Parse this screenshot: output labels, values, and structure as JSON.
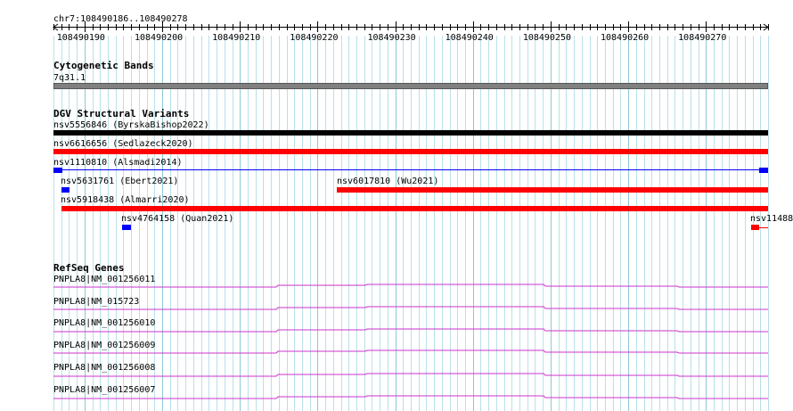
{
  "ruler": {
    "range_label": "chr7:108490186..108490278",
    "start": 108490186,
    "end": 108490278,
    "ticks": [
      "108490190",
      "108490200",
      "108490210",
      "108490220",
      "108490230",
      "108490240",
      "108490250",
      "108490260",
      "108490270"
    ]
  },
  "tracks": {
    "cytoband": {
      "title": "Cytogenetic Bands",
      "band_label": "7q31.1",
      "color": "#808080"
    },
    "dgv": {
      "title": "DGV Structural Variants",
      "features": [
        {
          "label": "nsv5556846 (ByrskaBishop2022)",
          "color": "#000000",
          "start": 108490186,
          "end": 108490278
        },
        {
          "label": "nsv6616656 (Sedlazeck2020)",
          "color": "#ff0000",
          "start": 108490186,
          "end": 108490278
        },
        {
          "label": "nsv1110810 (Alsmadi2014)",
          "color": "#0000ff",
          "start": 108490186,
          "end": 108490278
        },
        {
          "label": "nsv5631761 (Ebert2021)",
          "color": "#0000ff",
          "start": 108490187,
          "end": 108490188
        },
        {
          "label": "nsv6017810 (Wu2021)",
          "color": "#ff0000",
          "start": 108490222,
          "end": 108490278
        },
        {
          "label": "nsv5918438 (Almarri2020)",
          "color": "#ff0000",
          "start": 108490187,
          "end": 108490278
        },
        {
          "label": "nsv4764158 (Quan2021)",
          "color": "#0000ff",
          "start": 108490195,
          "end": 108490196
        },
        {
          "label": "nsv11488",
          "color": "#ff0000",
          "start": 108490277,
          "end": 108490278
        }
      ]
    },
    "refseq": {
      "title": "RefSeq Genes",
      "color": "#cc33cc",
      "genes": [
        {
          "label": "PNPLA8|NM_001256011"
        },
        {
          "label": "PNPLA8|NM_015723"
        },
        {
          "label": "PNPLA8|NM_001256010"
        },
        {
          "label": "PNPLA8|NM_001256009"
        },
        {
          "label": "PNPLA8|NM_001256008"
        },
        {
          "label": "PNPLA8|NM_001256007"
        }
      ]
    }
  }
}
